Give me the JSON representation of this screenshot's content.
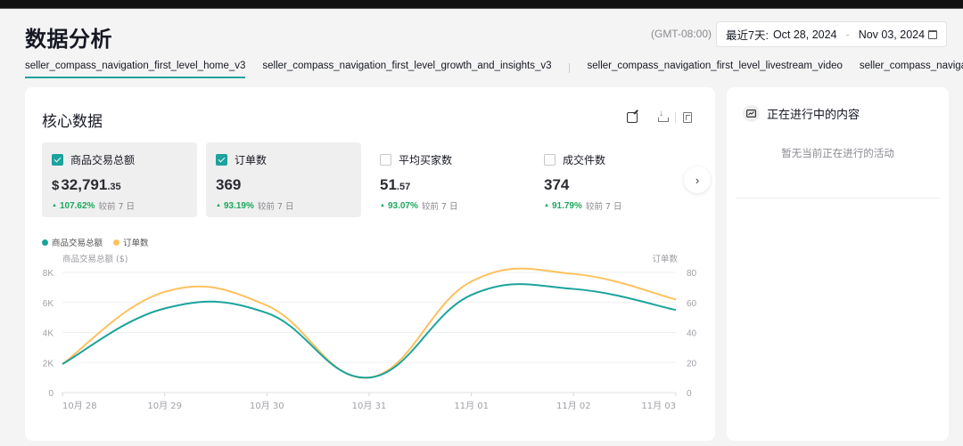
{
  "header": {
    "title": "数据分析",
    "timezone": "(GMT-08:00)",
    "date_range": {
      "prefix": "最近7天:",
      "start": "Oct 28, 2024",
      "separator": "-",
      "end": "Nov 03, 2024"
    }
  },
  "tabs": [
    {
      "label": "seller_compass_navigation_first_level_home_v3",
      "active": true
    },
    {
      "label": "seller_compass_navigation_first_level_growth_and_insights_v3",
      "active": false
    },
    {
      "label": "seller_compass_navigation_first_level_livestream_video",
      "active": false
    },
    {
      "label": "seller_compass_navigation_first_level_product",
      "active": false
    }
  ],
  "core": {
    "title": "核心数据",
    "tools": [
      "edit-icon",
      "download-icon",
      "report-icon"
    ],
    "metrics": [
      {
        "label": "商品交易总额",
        "checked": true,
        "currency": "$",
        "value": "32,791",
        "decimal": ".35",
        "change": "107.62%",
        "compare": "较前 7 日"
      },
      {
        "label": "订单数",
        "checked": true,
        "currency": "",
        "value": "369",
        "decimal": "",
        "change": "93.19%",
        "compare": "较前 7 日"
      },
      {
        "label": "平均买家数",
        "checked": false,
        "currency": "",
        "value": "51",
        "decimal": ".57",
        "change": "93.07%",
        "compare": "较前 7 日"
      },
      {
        "label": "成交件数",
        "checked": false,
        "currency": "",
        "value": "374",
        "decimal": "",
        "change": "91.79%",
        "compare": "较前 7 日"
      }
    ]
  },
  "side": {
    "title": "正在进行中的内容",
    "empty_text": "暂无当前正在进行的活动"
  },
  "colors": {
    "accent": "#1ba39c",
    "gmv": "#1ba39c",
    "orders": "#ffc15e",
    "up": "#1aa85b"
  },
  "chart_data": {
    "type": "line",
    "x": [
      "10月 28",
      "10月 29",
      "10月 30",
      "10月 31",
      "11月 01",
      "11月 02",
      "11月 03"
    ],
    "series": [
      {
        "name": "商品交易总额",
        "axis": "left",
        "values": [
          1900,
          5600,
          5300,
          1000,
          6500,
          6900,
          5500
        ]
      },
      {
        "name": "订单数",
        "axis": "right",
        "values": [
          19,
          67,
          58,
          10,
          74,
          79,
          62
        ]
      }
    ],
    "left_axis": {
      "label": "商品交易总额 ($)",
      "ticks": [
        "0",
        "2K",
        "4K",
        "6K",
        "8K"
      ],
      "range": [
        0,
        8000
      ]
    },
    "right_axis": {
      "label": "订单数",
      "ticks": [
        "0",
        "20",
        "40",
        "60",
        "80"
      ],
      "range": [
        0,
        80
      ]
    },
    "legend": [
      "商品交易总额",
      "订单数"
    ],
    "legend_position": "top-left",
    "grid": true
  }
}
